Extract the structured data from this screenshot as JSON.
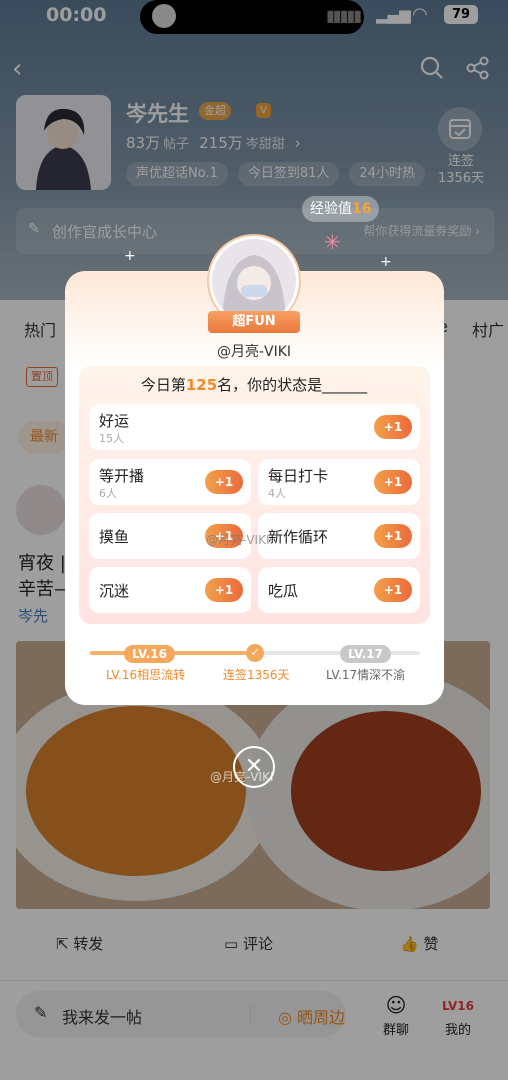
{
  "status_bar": {
    "time": "00:00",
    "battery": "79"
  },
  "profile": {
    "name": "岑先生",
    "badge": "金超",
    "posts_count": "83万",
    "posts_label": "帖子",
    "fans_count": "215万",
    "fans_label": "岑甜甜",
    "tags": [
      "声优超话No.1",
      "今日签到81人",
      "24小时热"
    ],
    "checkin_label": "连签",
    "checkin_days": "1356天"
  },
  "growth": {
    "title": "创作官成长中心",
    "hint": "帮你获得流量券奖励"
  },
  "exp_pill": {
    "label": "经验值",
    "value": "16"
  },
  "tabs": {
    "left": "热门",
    "right1": "ue",
    "right2": "村广"
  },
  "feed": {
    "pin_label": "置顶",
    "newest_label": "最新",
    "post_line1": "宵夜 |",
    "post_line2": "辛苦—",
    "post_author": "岑先",
    "actions": {
      "repost": "转发",
      "comment": "评论",
      "like": "赞"
    }
  },
  "bottom_bar": {
    "compose_placeholder": "我来发一帖",
    "share_label": "晒周边",
    "group_chat": "群聊",
    "mine": "我的",
    "mine_badge": "LV16"
  },
  "modal": {
    "fun_badge": "超FUN",
    "handle": "@月亮-VIKI",
    "rank_prefix": "今日第",
    "rank_number": "125",
    "rank_suffix": "名，你的状态是______",
    "options": [
      {
        "name": "好运",
        "count": "15人",
        "btn": "+1"
      },
      {
        "name": "等开播",
        "count": "6人",
        "btn": "+1"
      },
      {
        "name": "每日打卡",
        "count": "4人",
        "btn": "+1"
      },
      {
        "name": "摸鱼",
        "count": "",
        "btn": "+1"
      },
      {
        "name": "新作循环",
        "count": "",
        "btn": "+1"
      },
      {
        "name": "沉迷",
        "count": "",
        "btn": "+1"
      },
      {
        "name": "吃瓜",
        "count": "",
        "btn": "+1"
      }
    ],
    "level_current": "LV.16",
    "level_next": "LV.17",
    "level_current_text": "LV.16相思流转",
    "streak_text": "连签1356天",
    "level_next_text": "LV.17情深不渝"
  },
  "watermark": {
    "text1": "@月亮-VIKI",
    "text2": "@月亮-VIKI"
  },
  "icons": {
    "back": "chevron-left-icon",
    "search": "search-icon",
    "share": "share-icon",
    "calendar": "calendar-check-icon",
    "close": "close-icon"
  },
  "colors": {
    "accent": "#f08a2b",
    "header": "#6a8399"
  }
}
